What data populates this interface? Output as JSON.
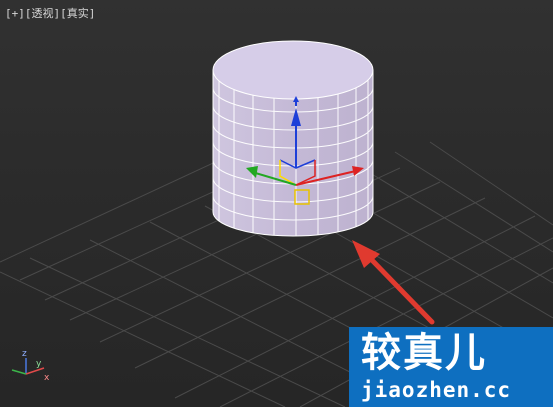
{
  "viewport": {
    "label_plus": "[+]",
    "label_view": "[透视]",
    "label_shading": "[真实]"
  },
  "scene": {
    "object": "cylinder",
    "gizmo": "move-gizmo",
    "annotation": "red-arrow",
    "axis_tripod_labels": [
      "z",
      "y",
      "x"
    ]
  },
  "watermark": {
    "title": "较真儿",
    "url": "jiaozhen.cc"
  },
  "colors": {
    "background": "#2b2b2b",
    "cylinder": "#c9bfd9",
    "grid": "#4a4a4a",
    "arrow": "#e03a2f",
    "watermark": "#0e6fc0"
  }
}
